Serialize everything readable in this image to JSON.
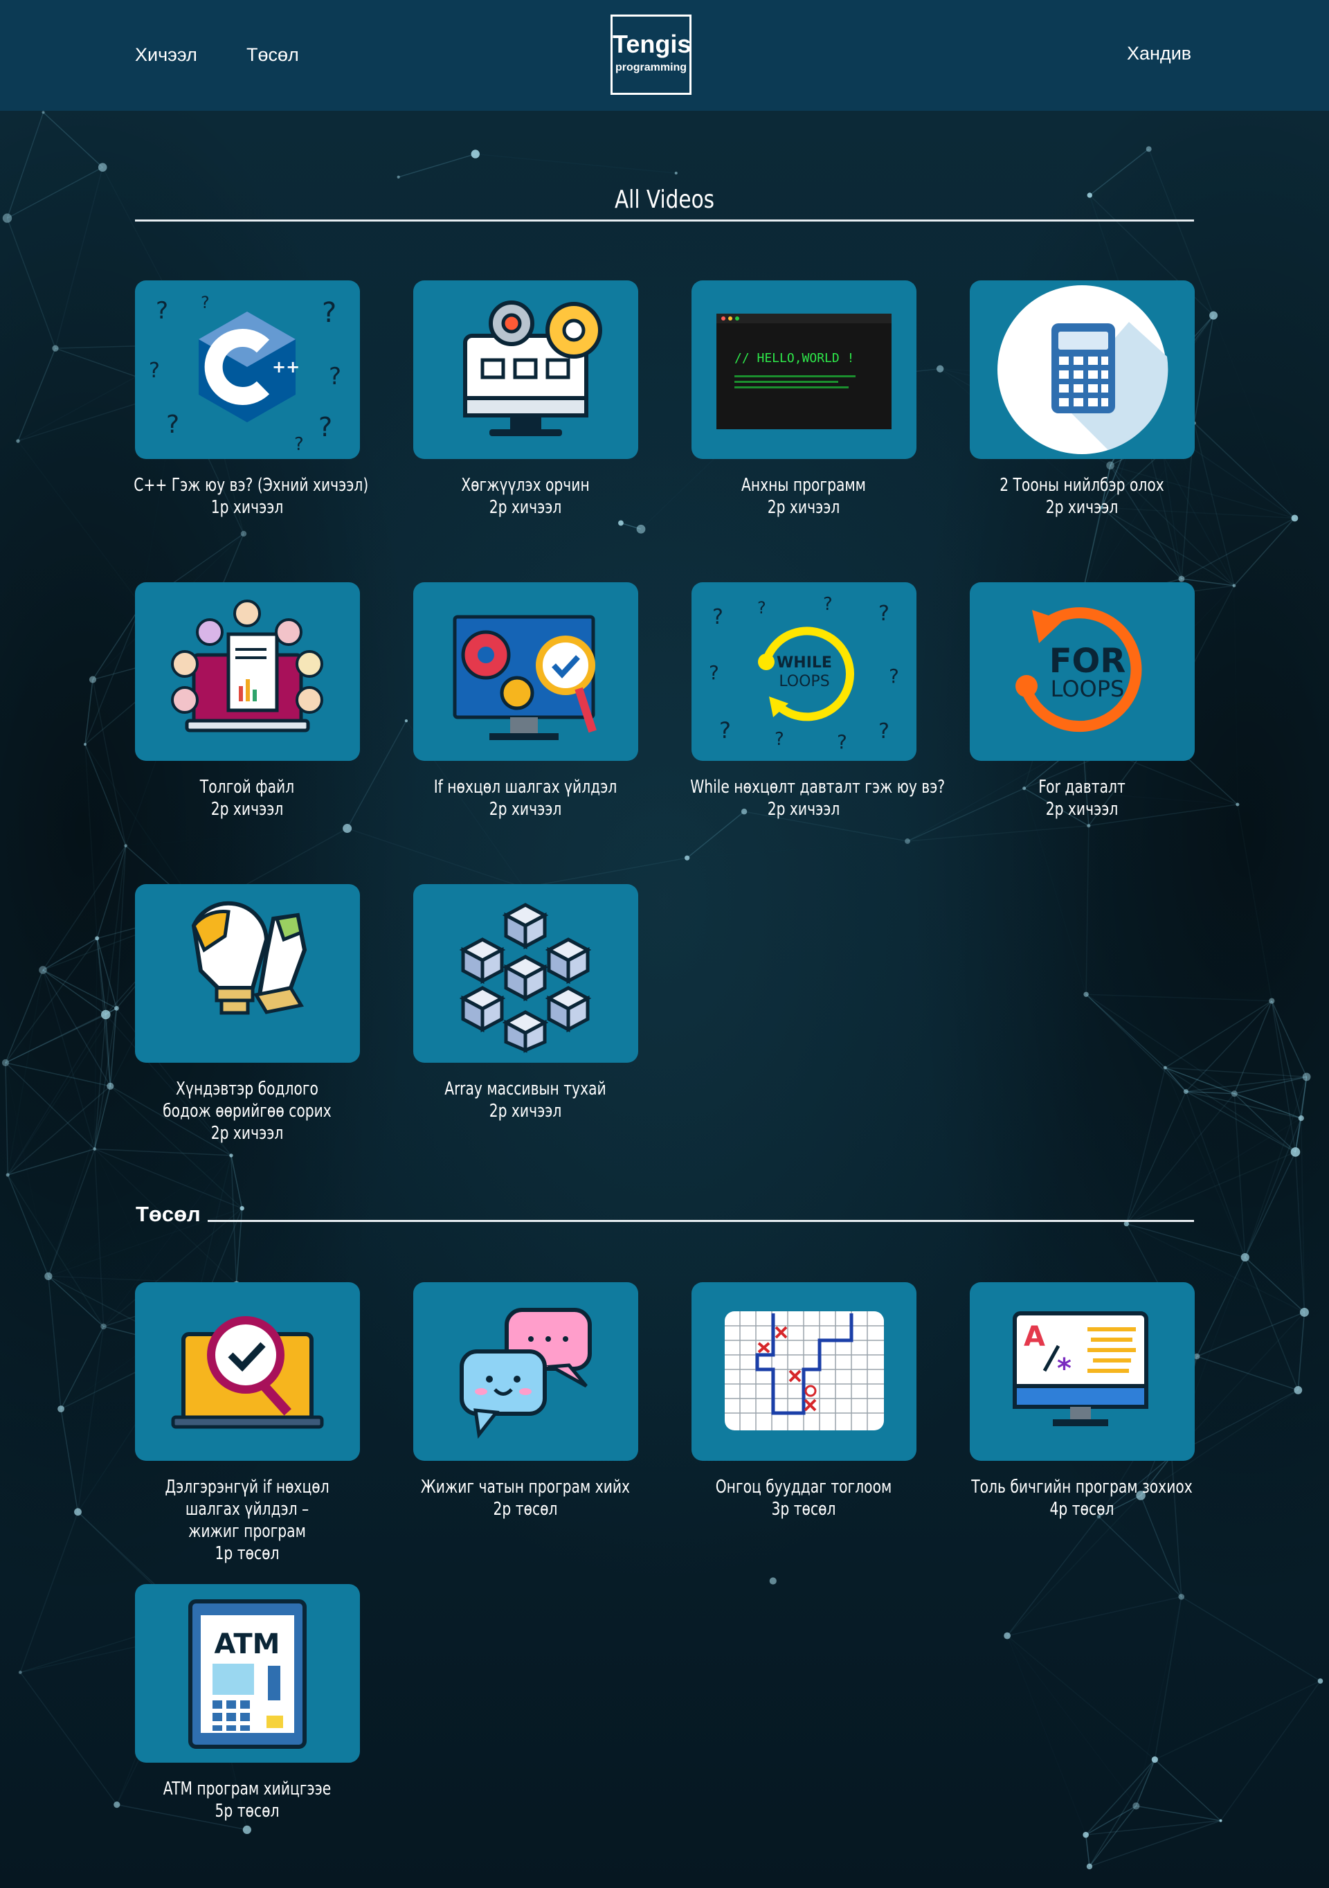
{
  "header": {
    "nav_lessons": "Хичээл",
    "nav_projects": "Төсөл",
    "logo_main": "Tengis",
    "logo_sub": "programming",
    "contact": "Хандив"
  },
  "colors": {
    "header_bg": "#0c3a54",
    "card_bg": "#107b9e",
    "page_bg": "#0a2431"
  },
  "videos_section": {
    "title": "All Videos",
    "items": [
      {
        "title": "C++ Гэж юу вэ? (Эхний хичээл)",
        "sub": "1р хичээл",
        "icon": "cpp-logo-icon"
      },
      {
        "title": "Хөгжүүлэх орчин",
        "sub": "2р хичээл",
        "icon": "computer-gears-icon"
      },
      {
        "title": "Анхны программ",
        "sub": "2р хичээл",
        "icon": "terminal-hello-world-icon",
        "code_text": "// HELLO,WORLD !"
      },
      {
        "title": "2 Тооны нийлбэр олох",
        "sub": "2р хичээл",
        "icon": "calculator-icon"
      },
      {
        "title": "Толгой файл",
        "sub": "2р хичээл",
        "icon": "laptop-files-icon"
      },
      {
        "title": "If нөхцөл шалгах үйлдэл",
        "sub": "2р хичээл",
        "icon": "monitor-check-icon"
      },
      {
        "title": "While нөхцөлт давталт гэж юу вэ?",
        "sub": "2р хичээл",
        "icon": "while-loop-icon",
        "badge_line1": "WHILE",
        "badge_line2": "LOOPS"
      },
      {
        "title": "For давталт",
        "sub": "2р хичээл",
        "icon": "for-loop-icon",
        "badge_line1": "FOR",
        "badge_line2": "LOOPS"
      },
      {
        "title": "Хүндэвтэр бодлого бодож өөрийгөө сорих",
        "sub": "2р хичээл",
        "icon": "lightbulb-puzzle-icon"
      },
      {
        "title": "Array массивын тухай",
        "sub": "2р хичээл",
        "icon": "cubes-array-icon"
      }
    ]
  },
  "projects_section": {
    "title": "Төсөл",
    "items": [
      {
        "title": "Дэлгэрэнгүй if нөхцөл шалгах үйлдэл – жижиг програм",
        "sub": "1р төсөл",
        "icon": "laptop-magnifier-icon"
      },
      {
        "title": "Жижиг чатын програм хийх",
        "sub": "2р төсөл",
        "icon": "chat-bubbles-icon"
      },
      {
        "title": "Онгоц бууддаг тоглоом",
        "sub": "3р төсөл",
        "icon": "grid-game-icon"
      },
      {
        "title": "Толь бичгийн програм зохиох",
        "sub": "4р төсөл",
        "icon": "dictionary-monitor-icon"
      },
      {
        "title": "ATM програм хийцгээе",
        "sub": "5р төсөл",
        "icon": "atm-icon",
        "badge_line1": "ATM"
      }
    ]
  }
}
